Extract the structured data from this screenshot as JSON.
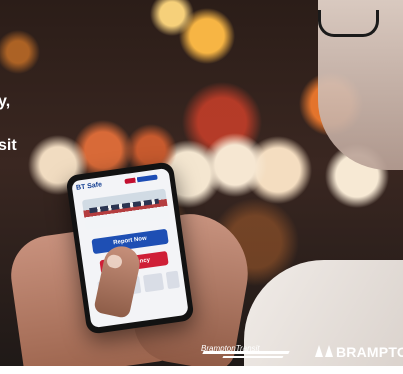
{
  "headline": {
    "line1": "y,",
    "line2": "sit"
  },
  "phone_screen": {
    "title": "BT Safe",
    "report_label": "Report Now",
    "emergency_label": "Emergency"
  },
  "logos": {
    "transit": "BramptonTransit",
    "city": "BRAMPTON"
  }
}
